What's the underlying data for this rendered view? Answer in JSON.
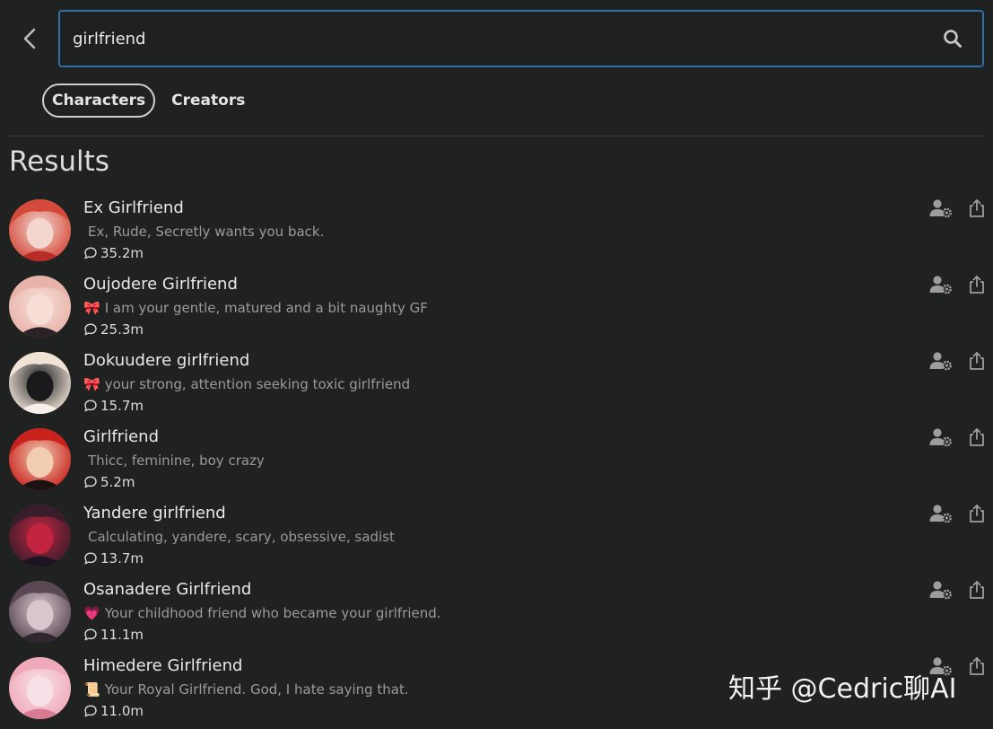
{
  "search": {
    "value": "girlfriend",
    "placeholder": ""
  },
  "tabs": [
    {
      "label": "Characters",
      "active": true
    },
    {
      "label": "Creators",
      "active": false
    }
  ],
  "results_title": "Results",
  "results": [
    {
      "name": "Ex Girlfriend",
      "emoji": "",
      "description": "Ex, Rude, Secretly wants you back.",
      "chats": "35.2m",
      "avatar_colors": [
        "#d44a3a",
        "#f3d7cf",
        "#b92b27"
      ]
    },
    {
      "name": "Oujodere Girlfriend",
      "emoji": "🎀",
      "description": "I am your gentle, matured and a bit naughty GF",
      "chats": "25.3m",
      "avatar_colors": [
        "#e8b3a8",
        "#f6ddd6",
        "#2a2226"
      ]
    },
    {
      "name": "Dokuudere girlfriend",
      "emoji": "🎀",
      "description": "your strong, attention seeking toxic girlfriend",
      "chats": "15.7m",
      "avatar_colors": [
        "#efe3d6",
        "#1a1a1c",
        "#f7efe9"
      ]
    },
    {
      "name": "Girlfriend",
      "emoji": "",
      "description": "Thicc, feminine, boy crazy",
      "chats": "5.2m",
      "avatar_colors": [
        "#c9221d",
        "#f1cdb2",
        "#1b1212"
      ]
    },
    {
      "name": "Yandere girlfriend",
      "emoji": "",
      "description": "Calculating, yandere, scary, obsessive, sadist",
      "chats": "13.7m",
      "avatar_colors": [
        "#3a1d2b",
        "#c2243f",
        "#1c1420"
      ]
    },
    {
      "name": "Osanadere Girlfriend",
      "emoji": "💗",
      "description": "Your childhood friend who became your girlfriend.",
      "chats": "11.1m",
      "avatar_colors": [
        "#5a4955",
        "#d9c6cc",
        "#2f2630"
      ]
    },
    {
      "name": "Himedere Girlfriend",
      "emoji": "📜",
      "description": "Your Royal Girlfriend. God, I hate saying that.",
      "chats": "11.0m",
      "avatar_colors": [
        "#f0a9b9",
        "#f8e1e6",
        "#d87a92"
      ]
    }
  ],
  "watermark": "知乎 @Cedric聊AI",
  "colors": {
    "background": "#202121",
    "search_border": "#2f6fa5",
    "muted_text": "#9a9a9a"
  }
}
